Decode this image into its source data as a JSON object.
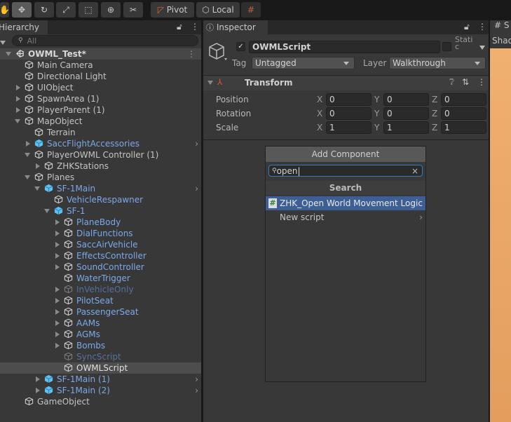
{
  "toolbar": {
    "tools": [
      "hand-icon",
      "move-icon",
      "rotate-icon",
      "scale-icon",
      "rect-icon",
      "transform-icon",
      "custom-tool-icon"
    ],
    "pivot": "Pivot",
    "local": "Local"
  },
  "hierarchy": {
    "tab": "Hierarchy",
    "search_placeholder": "All",
    "items": [
      {
        "label": "OWML_Test*",
        "level": 0,
        "type": "scene",
        "expand": "open"
      },
      {
        "label": "Main Camera",
        "level": 1
      },
      {
        "label": "Directional Light",
        "level": 1
      },
      {
        "label": "UIObject",
        "level": 1,
        "expand": "closed"
      },
      {
        "label": "SpawnArea (1)",
        "level": 1,
        "expand": "closed"
      },
      {
        "label": "PlayerParent (1)",
        "level": 1,
        "expand": "closed"
      },
      {
        "label": "MapObject",
        "level": 1,
        "expand": "open"
      },
      {
        "label": "Terrain",
        "level": 2
      },
      {
        "label": "SaccFlightAccessories",
        "level": 2,
        "type": "prefab",
        "expand": "closed",
        "style": "blue",
        "chevron": true
      },
      {
        "label": "PlayerOWML Controller (1)",
        "level": 2,
        "expand": "open"
      },
      {
        "label": "ZHKStations",
        "level": 3,
        "expand": "closed"
      },
      {
        "label": "Planes",
        "level": 2,
        "expand": "open"
      },
      {
        "label": "SF-1Main",
        "level": 3,
        "type": "prefab",
        "expand": "open",
        "style": "blue",
        "chevron": true
      },
      {
        "label": "VehicleRespawner",
        "level": 4,
        "style": "blue"
      },
      {
        "label": "SF-1",
        "level": 4,
        "type": "prefab",
        "expand": "open",
        "style": "blue"
      },
      {
        "label": "PlaneBody",
        "level": 5,
        "expand": "closed",
        "style": "blue"
      },
      {
        "label": "DialFunctions",
        "level": 5,
        "expand": "closed",
        "style": "blue"
      },
      {
        "label": "SaccAirVehicle",
        "level": 5,
        "expand": "closed",
        "style": "blue"
      },
      {
        "label": "EffectsController",
        "level": 5,
        "expand": "closed",
        "style": "blue"
      },
      {
        "label": "SoundController",
        "level": 5,
        "expand": "closed",
        "style": "blue"
      },
      {
        "label": "WaterTrigger",
        "level": 5,
        "style": "blue"
      },
      {
        "label": "InVehicleOnly",
        "level": 5,
        "expand": "closed",
        "style": "dim"
      },
      {
        "label": "PilotSeat",
        "level": 5,
        "expand": "closed",
        "style": "blue"
      },
      {
        "label": "PassengerSeat",
        "level": 5,
        "expand": "closed",
        "style": "blue"
      },
      {
        "label": "AAMs",
        "level": 5,
        "expand": "closed",
        "style": "blue"
      },
      {
        "label": "AGMs",
        "level": 5,
        "expand": "closed",
        "style": "blue"
      },
      {
        "label": "Bombs",
        "level": 5,
        "expand": "closed",
        "style": "blue"
      },
      {
        "label": "SyncScript",
        "level": 5,
        "style": "dim"
      },
      {
        "label": "OWMLScript",
        "level": 5,
        "selected": true,
        "style": "white"
      },
      {
        "label": "SF-1Main (1)",
        "level": 3,
        "type": "prefab",
        "expand": "closed",
        "style": "blue",
        "chevron": true
      },
      {
        "label": "SF-1Main (2)",
        "level": 3,
        "type": "prefab",
        "expand": "closed",
        "style": "blue",
        "chevron": true
      },
      {
        "label": "GameObject",
        "level": 1
      }
    ]
  },
  "inspector": {
    "tab": "Inspector",
    "object_name": "OWMLScript",
    "active": true,
    "static_label": "Stati c",
    "tag_label": "Tag",
    "tag": "Untagged",
    "layer_label": "Layer",
    "layer": "Walkthrough",
    "transform": {
      "title": "Transform",
      "rows": [
        {
          "label": "Position",
          "x": "0",
          "y": "0",
          "z": "0"
        },
        {
          "label": "Rotation",
          "x": "0",
          "y": "0",
          "z": "0"
        },
        {
          "label": "Scale",
          "x": "1",
          "y": "1",
          "z": "1"
        }
      ]
    },
    "add_component": {
      "button": "Add Component",
      "search_value": "open",
      "header": "Search",
      "results": [
        {
          "label": "ZHK_Open World Movement Logic",
          "selected": true
        },
        {
          "label": "New script",
          "submenu": true
        }
      ]
    }
  },
  "scene": {
    "tab": "S",
    "label": "Shad"
  },
  "colors": {
    "accent": "#3e5f96",
    "prefab": "#7ca8e8",
    "scene_ground": "#e9a769"
  }
}
